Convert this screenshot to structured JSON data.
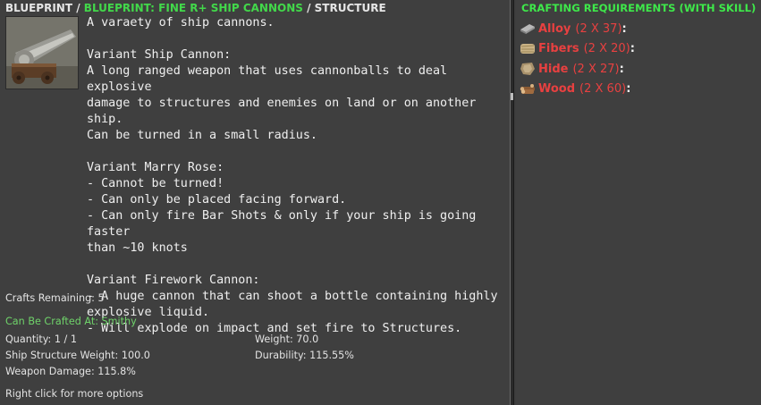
{
  "breadcrumb": {
    "part1": "BLUEPRINT",
    "sep1": " / ",
    "part2": "BLUEPRINT: FINE R+ SHIP CANNONS",
    "sep2": " / ",
    "part3": "STRUCTURE"
  },
  "item": {
    "icon": "ship-cannon-icon",
    "description": "A varaety of ship cannons.\n\nVariant Ship Cannon:\nA long ranged weapon that uses cannonballs to deal explosive\ndamage to structures and enemies on land or on another ship.\nCan be turned in a small radius.\n\nVariant Marry Rose:\n- Cannot be turned!\n- Can only be placed facing forward.\n- Can only fire Bar Shots & only if your ship is going faster\nthan ~10 knots\n\nVariant Firework Cannon:\n- A huge cannon that can shoot a bottle containing highly\nexplosive liquid.\n- Will explode on impact and set fire to Structures."
  },
  "stats": {
    "crafts_remaining": "Crafts Remaining: 5",
    "crafted_at": "Can Be Crafted At: Smithy",
    "quantity": "Quantity: 1 / 1",
    "weight": "Weight: 70.0",
    "ship_structure_weight": "Ship Structure Weight: 100.0",
    "durability": "Durability: 115.55%",
    "weapon_damage": "Weapon Damage: 115.8%",
    "hint": "Right click for more options"
  },
  "requirements": {
    "title": "CRAFTING REQUIREMENTS (WITH SKILL)",
    "items": [
      {
        "name": "Alloy",
        "qty": "(2 X 37)",
        "colon": ":",
        "icon": "alloy-ingot-icon"
      },
      {
        "name": "Fibers",
        "qty": "(2 X 20)",
        "colon": ":",
        "icon": "fibers-bundle-icon"
      },
      {
        "name": "Hide",
        "qty": "(2 X 27)",
        "colon": ":",
        "icon": "hide-icon"
      },
      {
        "name": "Wood",
        "qty": "(2 X 60)",
        "colon": ":",
        "icon": "wood-logs-icon"
      }
    ]
  },
  "colors": {
    "background": "#3f3f3f",
    "breadcrumb_accent": "#42d84a",
    "requirement_missing": "#e84040"
  }
}
